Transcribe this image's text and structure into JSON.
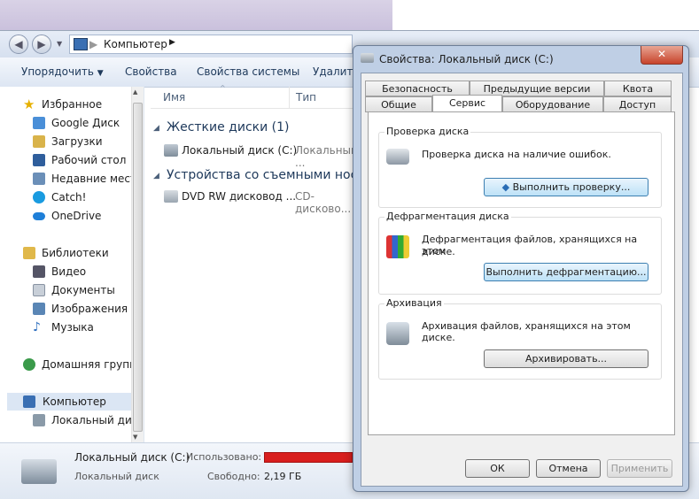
{
  "explorer": {
    "address": "Компьютер",
    "toolbar": {
      "organize": "Упорядочить",
      "properties": "Свойства",
      "system_properties": "Свойства системы",
      "uninstall": "Удалить"
    },
    "columns": {
      "name": "Имя",
      "type": "Тип"
    },
    "nav": {
      "favorites": "Избранное",
      "google_drive": "Google Диск",
      "downloads": "Загрузки",
      "desktop": "Рабочий стол",
      "recent": "Недавние места",
      "catch": "Catch!",
      "onedrive": "OneDrive",
      "libraries": "Библиотеки",
      "video": "Видео",
      "documents": "Документы",
      "images": "Изображения",
      "music": "Музыка",
      "homegroup": "Домашняя группа",
      "computer": "Компьютер",
      "local_disk": "Локальный диск"
    },
    "groups": {
      "hard_drives": "Жесткие диски (1)",
      "removable": "Устройства со съемными нос..."
    },
    "items": {
      "local_disk_name": "Локальный диск (C:)",
      "local_disk_type": "Локальный ...",
      "dvd_name": "DVD RW дисковод ...",
      "dvd_type": "CD-дисково..."
    },
    "status": {
      "name": "Локальный диск (C:)",
      "type": "Локальный диск",
      "used_label": "Использовано:",
      "free_label": "Свободно:",
      "free_value": "2,19 ГБ"
    }
  },
  "dialog": {
    "title": "Свойства: Локальный диск (C:)",
    "close": "✕",
    "tabs_row1": [
      "Безопасность",
      "Предыдущие версии",
      "Квота"
    ],
    "tabs_row2": [
      "Общие",
      "Сервис",
      "Оборудование",
      "Доступ"
    ],
    "active_tab": "Сервис",
    "check": {
      "title": "Проверка диска",
      "desc": "Проверка диска на наличие ошибок.",
      "button": "Выполнить проверку..."
    },
    "defrag": {
      "title": "Дефрагментация диска",
      "desc_line1": "Дефрагментация файлов, хранящихся на этом",
      "desc_line2": "диске.",
      "button": "Выполнить дефрагментацию..."
    },
    "backup": {
      "title": "Архивация",
      "desc": "Архивация файлов, хранящихся на этом диске.",
      "button": "Архивировать..."
    },
    "footer": {
      "ok": "ОК",
      "cancel": "Отмена",
      "apply": "Применить"
    }
  },
  "colors": {
    "accent": "#1e395b",
    "used_bar": "#d81e1e"
  }
}
